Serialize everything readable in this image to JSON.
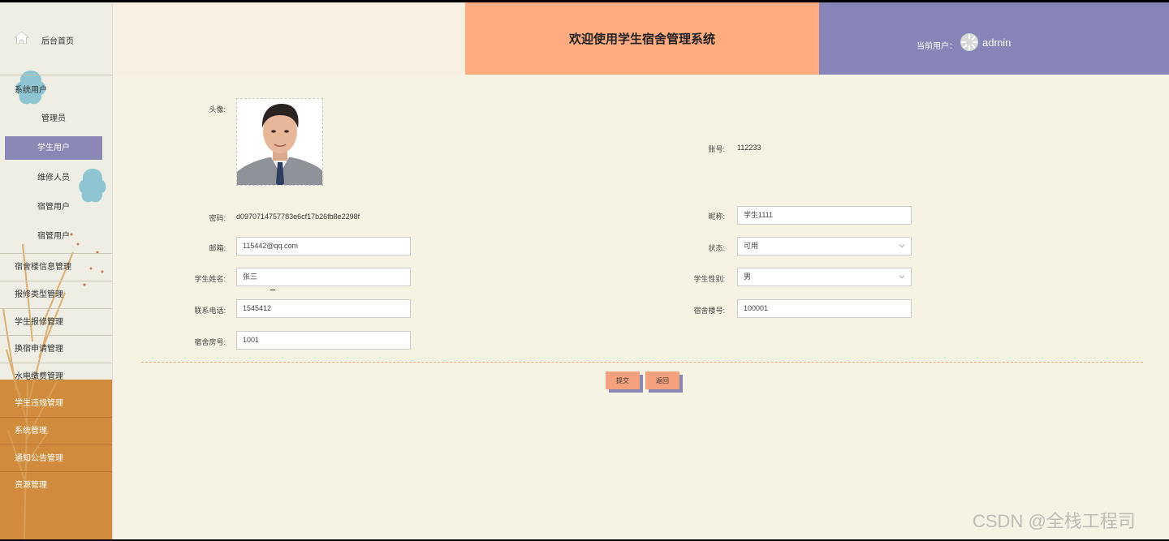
{
  "sidebar": {
    "home_label": "后台首页",
    "section_label": "系统用户",
    "sub_items": [
      "管理员",
      "学生用户",
      "维修人员",
      "宿管用户",
      "宿管用户"
    ],
    "items": [
      "宿舍楼信息管理",
      "报修类型管理",
      "学生报修管理",
      "换宿申请管理",
      "水电缴费管理",
      "学生违规管理",
      "系统管理",
      "通知公告管理",
      "资源管理"
    ],
    "active": "学生用户"
  },
  "header": {
    "title": "欢迎使用学生宿舍管理系统",
    "user_label": "当前用户：",
    "user_name": "admin"
  },
  "form": {
    "avatar_label": "头像:",
    "account_label": "账号:",
    "account_value": "112233",
    "password_label": "密码:",
    "password_value": "d0970714757783e6cf17b26fb8e2298f",
    "nickname_label": "昵称:",
    "nickname_value": "学生1111",
    "email_label": "邮箱:",
    "email_value": "115442@qq.com",
    "status_label": "状态:",
    "status_value": "可用",
    "student_name_label": "学生姓名:",
    "student_name_value": "张三",
    "gender_label": "学生性别:",
    "gender_value": "男",
    "phone_label": "联系电话:",
    "phone_value": "1545412",
    "building_label": "宿舍楼号:",
    "building_value": "100001",
    "room_label": "宿舍房号:",
    "room_value": "1001"
  },
  "buttons": {
    "submit": "提交",
    "back": "返回"
  },
  "watermark": "CSDN @全栈工程司",
  "colors": {
    "accent": "#fdab7f",
    "header_right": "#8785b7",
    "sidebar_lower": "#d08b3c",
    "background": "#f7f3e4"
  }
}
